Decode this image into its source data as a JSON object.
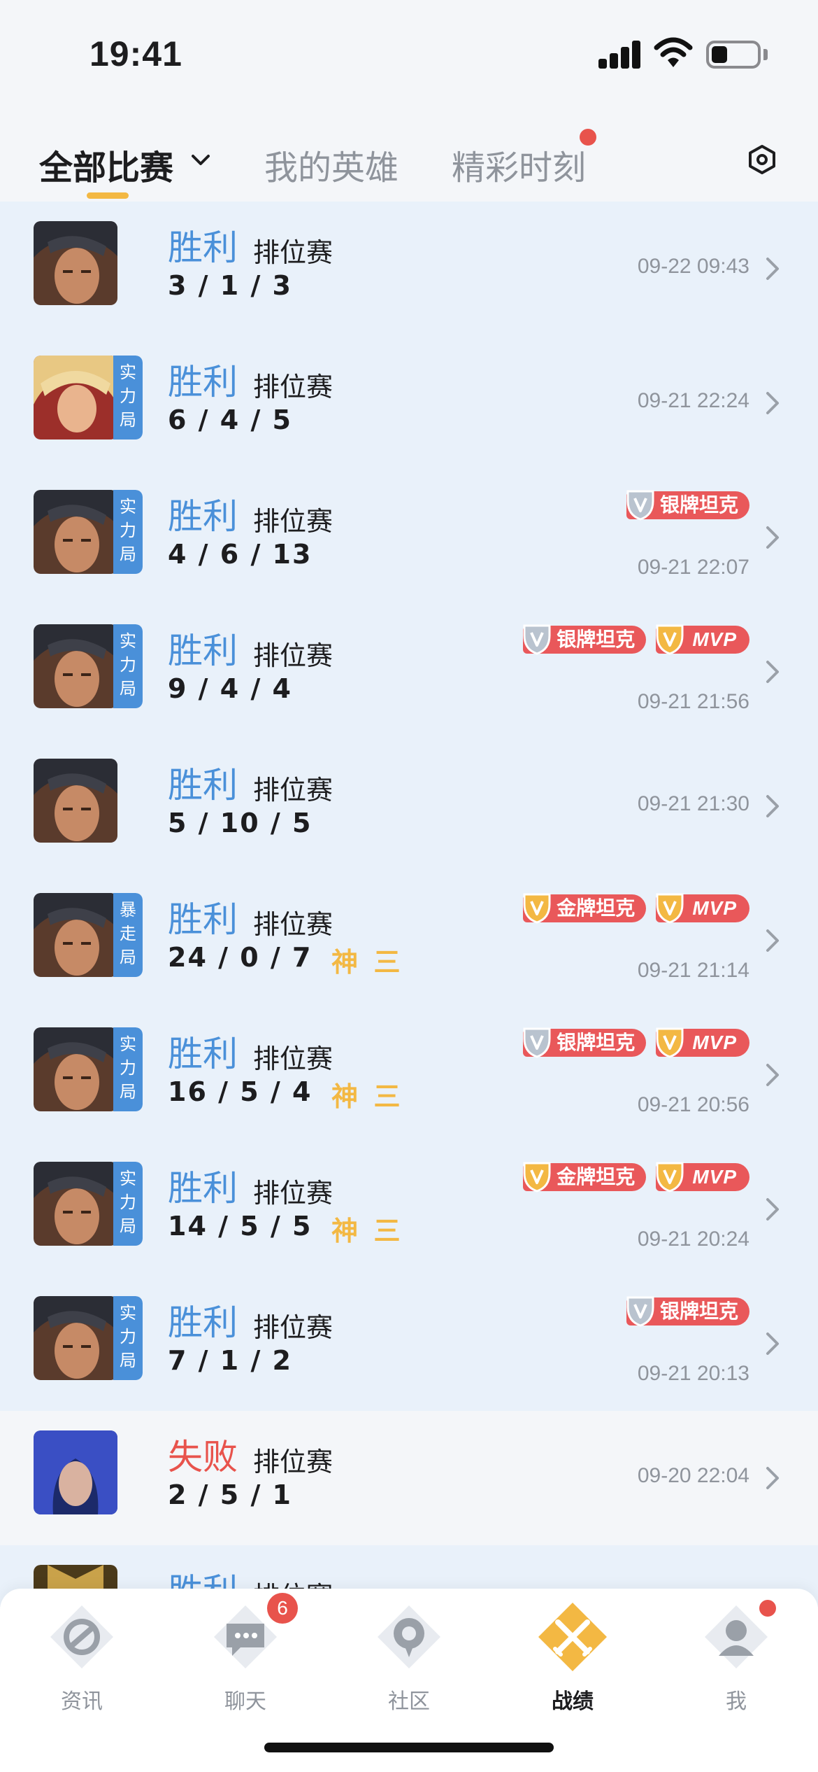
{
  "status_bar": {
    "time": "19:41"
  },
  "tabs": [
    {
      "label": "全部比赛",
      "active": true
    },
    {
      "label": "我的英雄",
      "active": false
    },
    {
      "label": "精彩时刻",
      "active": false,
      "has_dot": true
    }
  ],
  "matches": [
    {
      "result": "胜利",
      "mode": "排位赛",
      "kda": "3 / 1 / 3",
      "time": "09-22 09:43",
      "hero": "dark-hair",
      "tag": "",
      "badges": []
    },
    {
      "result": "胜利",
      "mode": "排位赛",
      "kda": "6 / 4 / 5",
      "time": "09-21 22:24",
      "hero": "blonde",
      "tag": "实力局",
      "badges": []
    },
    {
      "result": "胜利",
      "mode": "排位赛",
      "kda": "4 / 6 / 13",
      "time": "09-21 22:07",
      "hero": "dark-hair",
      "tag": "实力局",
      "badges": [
        "银牌坦克"
      ]
    },
    {
      "result": "胜利",
      "mode": "排位赛",
      "kda": "9 / 4 / 4",
      "time": "09-21 21:56",
      "hero": "dark-hair",
      "tag": "实力局",
      "badges": [
        "银牌坦克",
        "MVP"
      ]
    },
    {
      "result": "胜利",
      "mode": "排位赛",
      "kda": "5 / 10 / 5",
      "time": "09-21 21:30",
      "hero": "dark-hair",
      "tag": "",
      "badges": []
    },
    {
      "result": "胜利",
      "mode": "排位赛",
      "kda": "24 / 0 / 7",
      "kda_extra": "神 三",
      "time": "09-21 21:14",
      "hero": "dark-hair",
      "tag": "暴走局",
      "badges": [
        "金牌坦克",
        "MVP"
      ]
    },
    {
      "result": "胜利",
      "mode": "排位赛",
      "kda": "16 / 5 / 4",
      "kda_extra": "神 三",
      "time": "09-21 20:56",
      "hero": "dark-hair",
      "tag": "实力局",
      "badges": [
        "银牌坦克",
        "MVP"
      ]
    },
    {
      "result": "胜利",
      "mode": "排位赛",
      "kda": "14 / 5 / 5",
      "kda_extra": "神 三",
      "time": "09-21 20:24",
      "hero": "dark-hair",
      "tag": "实力局",
      "badges": [
        "金牌坦克",
        "MVP"
      ]
    },
    {
      "result": "胜利",
      "mode": "排位赛",
      "kda": "7 / 1 / 2",
      "time": "09-21 20:13",
      "hero": "dark-hair",
      "tag": "实力局",
      "badges": [
        "银牌坦克"
      ]
    },
    {
      "result": "失败",
      "mode": "排位赛",
      "kda": "2 / 5 / 1",
      "time": "09-20 22:04",
      "hero": "blue-hair",
      "tag": "",
      "badges": []
    },
    {
      "result": "胜利",
      "mode": "排位赛",
      "kda": "",
      "time": "",
      "hero": "gold-helm",
      "tag": "",
      "badges": []
    }
  ],
  "bottom_nav": [
    {
      "label": "资讯",
      "icon": "news-icon"
    },
    {
      "label": "聊天",
      "icon": "chat-icon",
      "badge": "6"
    },
    {
      "label": "社区",
      "icon": "community-icon"
    },
    {
      "label": "战绩",
      "icon": "record-icon",
      "active": true
    },
    {
      "label": "我",
      "icon": "profile-icon",
      "has_dot": true
    }
  ],
  "colors": {
    "win": "#4a90d9",
    "lose": "#e8534c",
    "accent": "#f3b843",
    "badge_red": "#e9585a"
  }
}
